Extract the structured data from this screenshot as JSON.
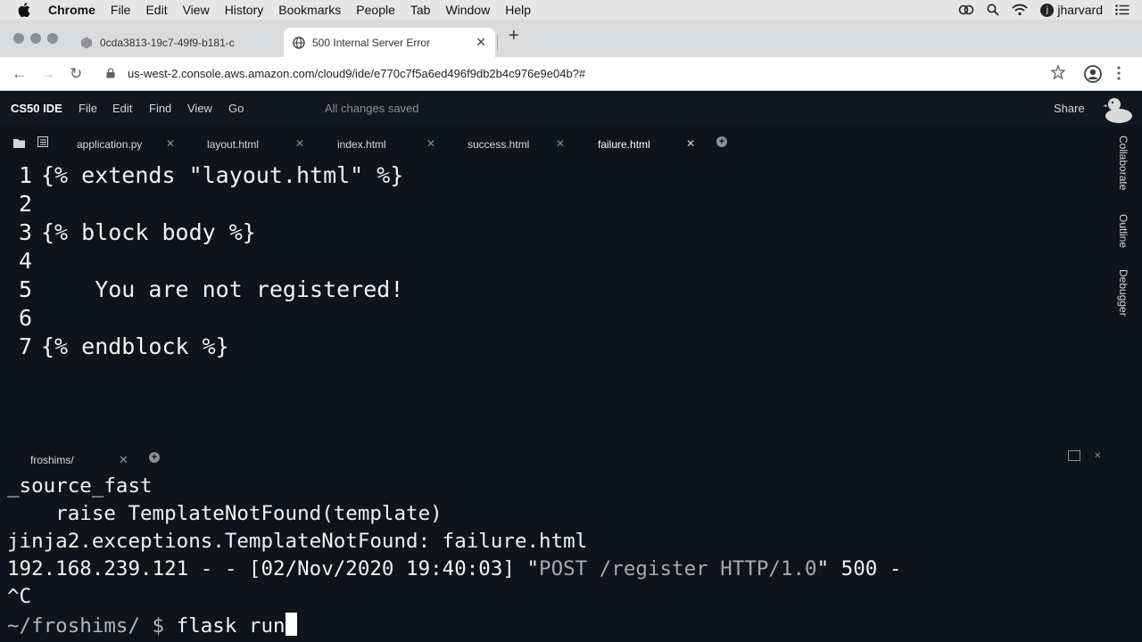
{
  "menubar": {
    "app": "Chrome",
    "items": [
      "File",
      "Edit",
      "View",
      "History",
      "Bookmarks",
      "People",
      "Tab",
      "Window",
      "Help"
    ],
    "user_initial": "j",
    "user": "jharvard"
  },
  "browser": {
    "tabs": [
      {
        "title": "0cda3813-19c7-49f9-b181-c",
        "active": false
      },
      {
        "title": "500 Internal Server Error",
        "active": true
      }
    ],
    "url": "us-west-2.console.aws.amazon.com/cloud9/ide/e770c7f5a6ed496f9db2b4c976e9e04b?#"
  },
  "ide": {
    "brand": "CS50 IDE",
    "menu": [
      "File",
      "Edit",
      "Find",
      "View",
      "Go"
    ],
    "status": "All changes saved",
    "share": "Share",
    "sidebar": [
      "Collaborate",
      "Outline",
      "Debugger"
    ]
  },
  "editor_tabs": [
    "application.py",
    "layout.html",
    "index.html",
    "success.html",
    "failure.html"
  ],
  "code": [
    {
      "num": "1",
      "text": "{% extends \"layout.html\" %}"
    },
    {
      "num": "2",
      "text": ""
    },
    {
      "num": "3",
      "text": "{% block body %}"
    },
    {
      "num": "4",
      "text": ""
    },
    {
      "num": "5",
      "text": "    You are not registered!"
    },
    {
      "num": "6",
      "text": ""
    },
    {
      "num": "7",
      "text": "{% endblock %}"
    }
  ],
  "terminal": {
    "tab": "froshims/",
    "lines": [
      "_source_fast",
      "    raise TemplateNotFound(template)",
      "jinja2.exceptions.TemplateNotFound: failure.html"
    ],
    "log_prefix": "192.168.239.121 - - [02/Nov/2020 19:40:03] \"",
    "log_request": "POST /register HTTP/1.0",
    "log_suffix": "\" 500 -",
    "interrupt": "^C",
    "prompt": "~/froshims/ $",
    "command": " flask run"
  },
  "colors": {
    "editor_bg": "#0f131b",
    "ide_menu_bg": "#121620",
    "text": "#f2f2f2",
    "dim_text": "#a7a9ad"
  }
}
